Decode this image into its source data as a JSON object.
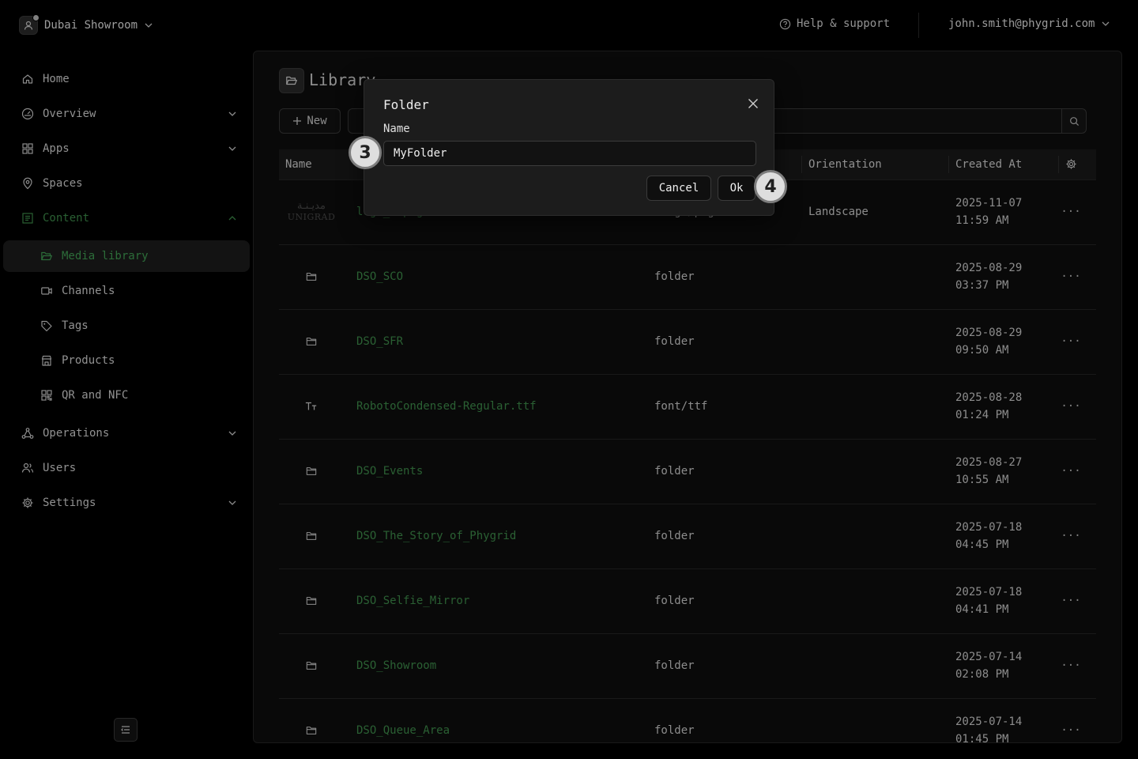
{
  "topbar": {
    "workspace": "Dubai Showroom",
    "help": "Help & support",
    "user_email": "john.smith@phygrid.com"
  },
  "sidebar": {
    "items": [
      {
        "label": "Home"
      },
      {
        "label": "Overview"
      },
      {
        "label": "Apps"
      },
      {
        "label": "Spaces"
      },
      {
        "label": "Content"
      },
      {
        "label": "Media library"
      },
      {
        "label": "Channels"
      },
      {
        "label": "Tags"
      },
      {
        "label": "Products"
      },
      {
        "label": "QR and NFC"
      },
      {
        "label": "Operations"
      },
      {
        "label": "Users"
      },
      {
        "label": "Settings"
      }
    ]
  },
  "library": {
    "title": "Library",
    "new_label": "New",
    "search_placeholder": ""
  },
  "table": {
    "columns": [
      "Name",
      "Orientation",
      "Created At"
    ],
    "rows": [
      {
        "name": "logo_1.png",
        "type": "image/png",
        "orientation": "Landscape",
        "date": "2025-11-07",
        "time": "11:59 AM",
        "thumb_ar": "مديـنـة",
        "thumb_en": "UNIGRAD"
      },
      {
        "name": "DSO_SCO",
        "type": "folder",
        "orientation": "",
        "date": "2025-08-29",
        "time": "03:37 PM"
      },
      {
        "name": "DSO_SFR",
        "type": "folder",
        "orientation": "",
        "date": "2025-08-29",
        "time": "09:50 AM"
      },
      {
        "name": "RobotoCondensed-Regular.ttf",
        "type": "font/ttf",
        "orientation": "",
        "date": "2025-08-28",
        "time": "01:24 PM"
      },
      {
        "name": "DSO_Events",
        "type": "folder",
        "orientation": "",
        "date": "2025-08-27",
        "time": "10:55 AM"
      },
      {
        "name": "DSO_The_Story_of_Phygrid",
        "type": "folder",
        "orientation": "",
        "date": "2025-07-18",
        "time": "04:45 PM"
      },
      {
        "name": "DSO_Selfie_Mirror",
        "type": "folder",
        "orientation": "",
        "date": "2025-07-18",
        "time": "04:41 PM"
      },
      {
        "name": "DSO_Showroom",
        "type": "folder",
        "orientation": "",
        "date": "2025-07-14",
        "time": "02:08 PM"
      },
      {
        "name": "DSO_Queue_Area",
        "type": "folder",
        "orientation": "",
        "date": "2025-07-14",
        "time": "01:45 PM"
      }
    ],
    "more_glyph": "···"
  },
  "modal": {
    "title": "Folder",
    "name_label": "Name",
    "name_value": "MyFolder",
    "cancel_label": "Cancel",
    "ok_label": "Ok"
  },
  "steps": {
    "input_step": "3",
    "ok_step": "4"
  },
  "colors": {
    "accent_green": "#41a054",
    "background": "#000000",
    "panel": "#0e0e0e"
  }
}
